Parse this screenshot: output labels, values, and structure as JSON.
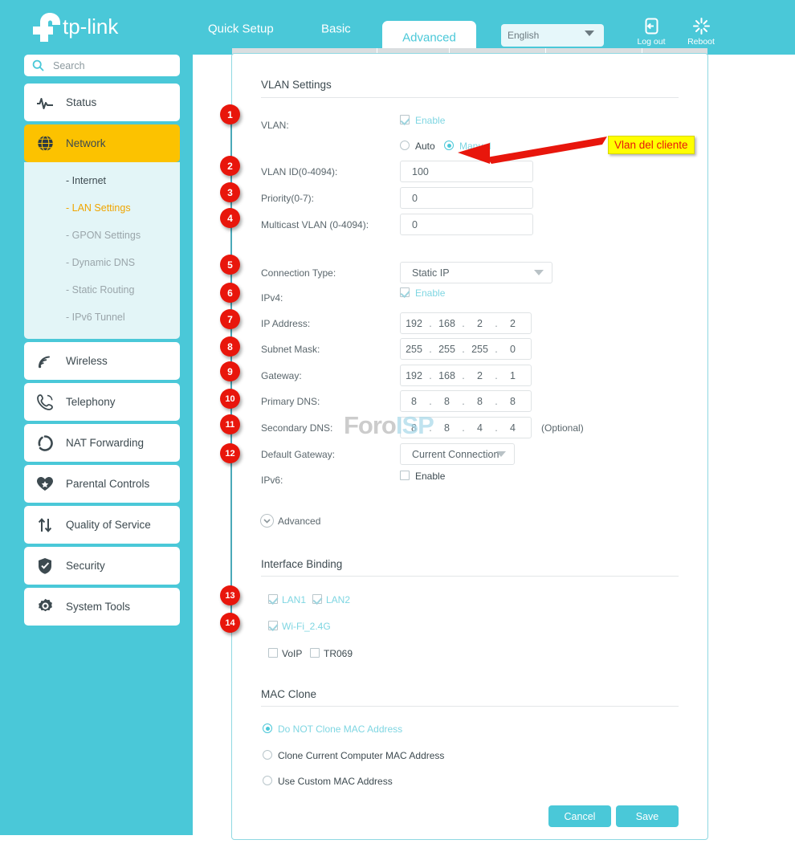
{
  "brand": {
    "name": "tp-link"
  },
  "header": {
    "nav": [
      {
        "label": "Quick Setup",
        "active": false
      },
      {
        "label": "Basic",
        "active": false
      },
      {
        "label": "Advanced",
        "active": true
      }
    ],
    "language": {
      "value": "English",
      "options": [
        "English"
      ]
    },
    "logout_label": "Log out",
    "reboot_label": "Reboot",
    "logout_icon": "logout-icon",
    "reboot_icon": "reboot-icon"
  },
  "sidebar": {
    "search": {
      "placeholder": "Search",
      "value": "",
      "icon": "search-icon"
    },
    "items": [
      {
        "label": "Status",
        "icon": "pulse-icon",
        "active": false
      },
      {
        "label": "Network",
        "icon": "globe-icon",
        "active": true
      },
      {
        "label": "Wireless",
        "icon": "wifi-icon",
        "active": false
      },
      {
        "label": "Telephony",
        "icon": "phone-icon",
        "active": false
      },
      {
        "label": "NAT Forwarding",
        "icon": "nat-icon",
        "active": false
      },
      {
        "label": "Parental Controls",
        "icon": "heart-icon",
        "active": false
      },
      {
        "label": "Quality of Service",
        "icon": "arrows-updown-icon",
        "active": false
      },
      {
        "label": "Security",
        "icon": "shield-icon",
        "active": false
      },
      {
        "label": "System Tools",
        "icon": "gear-icon",
        "active": false
      }
    ],
    "subitems": [
      {
        "label": "- Internet",
        "state": "dark"
      },
      {
        "label": "- LAN Settings",
        "state": "selected"
      },
      {
        "label": "- GPON Settings",
        "state": "normal"
      },
      {
        "label": "- Dynamic DNS",
        "state": "normal"
      },
      {
        "label": "- Static Routing",
        "state": "normal"
      },
      {
        "label": "- IPv6 Tunnel",
        "state": "normal"
      }
    ]
  },
  "main": {
    "vlan_section": {
      "title": "VLAN Settings",
      "vlan_label": "VLAN:",
      "vlan_enable_label": "Enable",
      "vlan_enable_checked": true,
      "mode_auto_label": "Auto",
      "mode_manual_label": "Manual",
      "mode_selected": "Manual",
      "vlan_id_label": "VLAN ID(0-4094):",
      "vlan_id_value": "100",
      "priority_label": "Priority(0-7):",
      "priority_value": "0",
      "multicast_label": "Multicast VLAN (0-4094):",
      "multicast_value": "0"
    },
    "connection": {
      "conn_type_label": "Connection Type:",
      "conn_type_value": "Static IP",
      "ipv4_label": "IPv4:",
      "ipv4_enable_label": "Enable",
      "ipv4_enable_checked": true,
      "ip_label": "IP Address:",
      "ip_value": [
        "192",
        "168",
        "2",
        "2"
      ],
      "mask_label": "Subnet Mask:",
      "mask_value": [
        "255",
        "255",
        "255",
        "0"
      ],
      "gw_label": "Gateway:",
      "gw_value": [
        "192",
        "168",
        "2",
        "1"
      ],
      "dns1_label": "Primary DNS:",
      "dns1_value": [
        "8",
        "8",
        "8",
        "8"
      ],
      "dns2_label": "Secondary DNS:",
      "dns2_value": [
        "8",
        "8",
        "4",
        "4"
      ],
      "dns2_optional": "(Optional)",
      "default_gw_label": "Default Gateway:",
      "default_gw_value": "Current Connection",
      "ipv6_label": "IPv6:",
      "ipv6_enable_label": "Enable",
      "ipv6_enable_checked": false,
      "advanced_label": "Advanced"
    },
    "interface_binding": {
      "title": "Interface Binding",
      "items": [
        {
          "label": "LAN1",
          "checked": true
        },
        {
          "label": "LAN2",
          "checked": true
        },
        {
          "label": "Wi-Fi_2.4G",
          "checked": true
        },
        {
          "label": "VoIP",
          "checked": false
        },
        {
          "label": "TR069",
          "checked": false
        }
      ]
    },
    "mac_clone": {
      "title": "MAC Clone",
      "options": [
        {
          "label": "Do NOT Clone MAC Address",
          "selected": true
        },
        {
          "label": "Clone Current Computer MAC Address",
          "selected": false
        },
        {
          "label": "Use Custom MAC Address",
          "selected": false
        }
      ]
    },
    "buttons": {
      "cancel": "Cancel",
      "save": "Save"
    }
  },
  "annotations": {
    "badges": [
      "1",
      "2",
      "3",
      "4",
      "5",
      "6",
      "7",
      "8",
      "9",
      "10",
      "11",
      "12",
      "13",
      "14"
    ],
    "callout_text": "Vlan del cliente",
    "callout_color": "#ffff00",
    "arrow_color": "#e8160c",
    "badge_color": "#e8160c"
  },
  "watermark": {
    "part1": "Foro",
    "part2": "ISP"
  },
  "colors": {
    "teal": "#4ac8d8",
    "amber": "#fcc200",
    "accent_text": "#7fd6e2"
  }
}
